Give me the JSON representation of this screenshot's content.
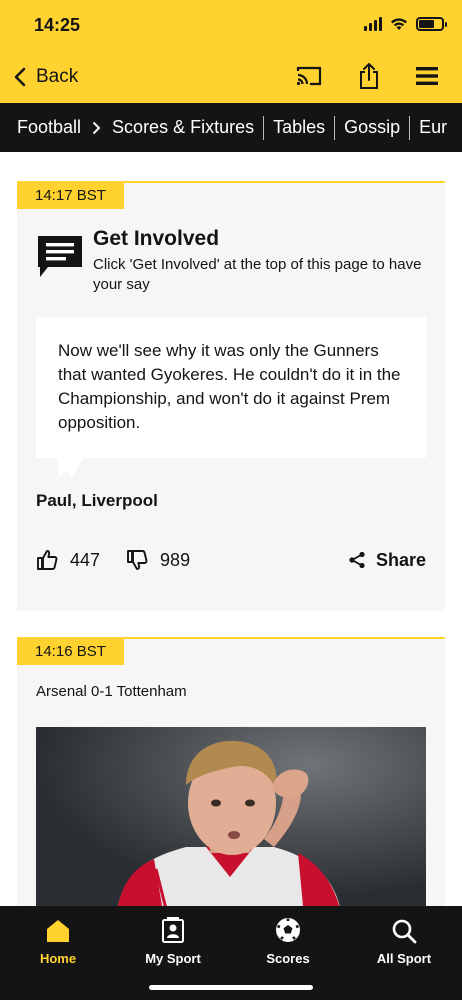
{
  "status_bar": {
    "time": "14:25"
  },
  "header": {
    "back_label": "Back"
  },
  "breadcrumbs": {
    "items": [
      "Football",
      "Scores & Fixtures",
      "Tables",
      "Gossip",
      "Eur"
    ]
  },
  "posts": [
    {
      "time": "14:17 BST",
      "title": "Get Involved",
      "subtitle": "Click 'Get Involved' at the top of this page to have your say",
      "quote": "Now we'll see why it was only the Gunners that wanted Gyokeres. He couldn't do it in the Championship, and won't do it against Prem opposition.",
      "author": "Paul, Liverpool",
      "likes": "447",
      "dislikes": "989",
      "share_label": "Share"
    },
    {
      "time": "14:16 BST",
      "text": "Arsenal 0-1 Tottenham"
    }
  ],
  "tabbar": {
    "tabs": [
      {
        "label": "Home",
        "icon": "home-icon",
        "active": true
      },
      {
        "label": "My Sport",
        "icon": "my-sport-icon",
        "active": false
      },
      {
        "label": "Scores",
        "icon": "football-icon",
        "active": false
      },
      {
        "label": "All Sport",
        "icon": "search-icon",
        "active": false
      }
    ]
  },
  "colors": {
    "accent": "#ffd230",
    "dark": "#141414",
    "card": "#f6f6f6"
  }
}
